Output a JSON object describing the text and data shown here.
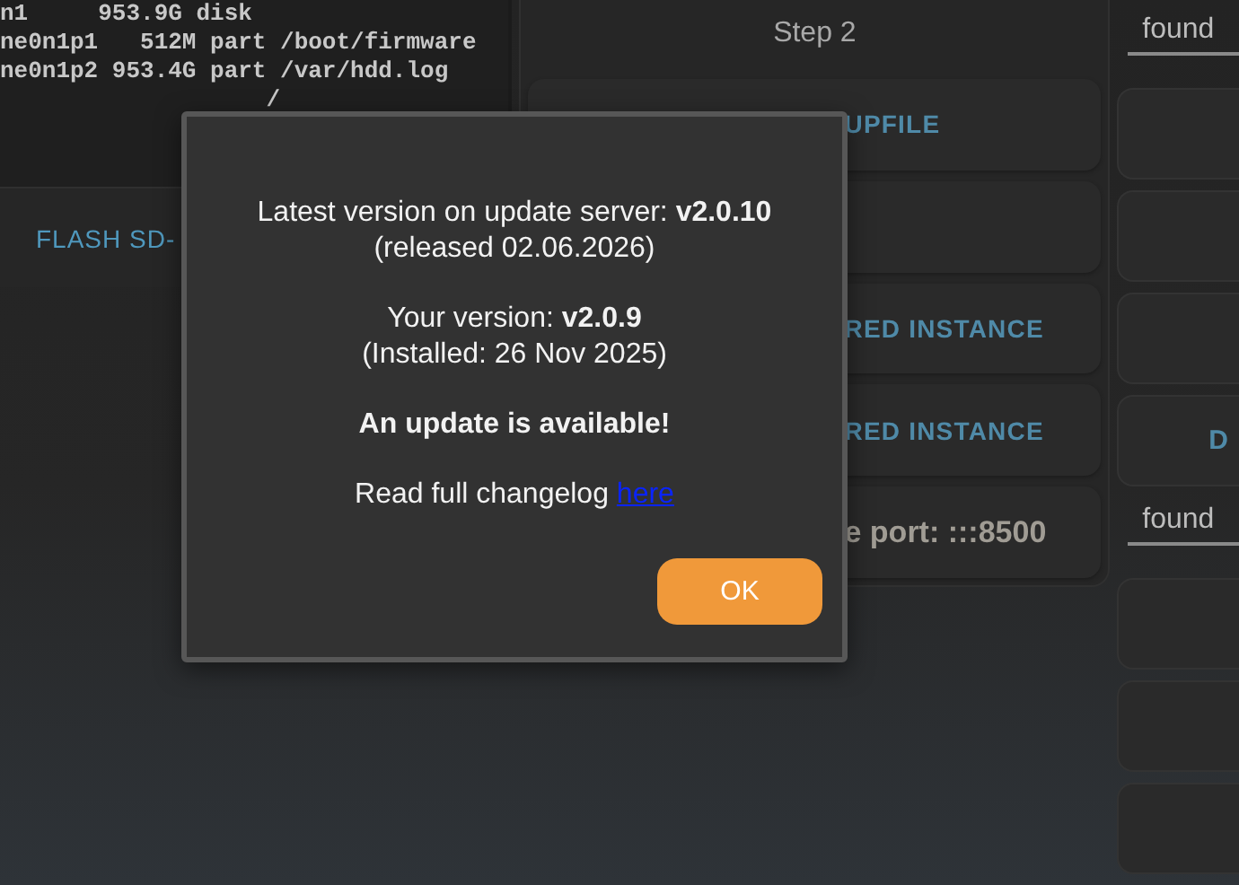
{
  "terminal": {
    "lines": [
      "n1     953.9G disk",
      "ne0n1p1   512M part /boot/firmware",
      "ne0n1p2 953.4G part /var/hdd.log",
      "                   /"
    ]
  },
  "left_panel": {
    "button": "FLASH SD-"
  },
  "middle_panel": {
    "title": "Step 2",
    "rows": [
      {
        "kind": "button",
        "label": "UPFILE"
      },
      {
        "kind": "empty"
      },
      {
        "kind": "button",
        "label": "RED INSTANCE"
      },
      {
        "kind": "button",
        "label": "RED INSTANCE"
      },
      {
        "kind": "status",
        "label": "e port: :::8500"
      }
    ]
  },
  "right_column": {
    "items": [
      {
        "kind": "field",
        "value": "found"
      },
      {
        "kind": "empty"
      },
      {
        "kind": "empty"
      },
      {
        "kind": "empty"
      },
      {
        "kind": "button",
        "label": "D"
      },
      {
        "kind": "field",
        "value": "found"
      },
      {
        "kind": "empty"
      },
      {
        "kind": "empty"
      },
      {
        "kind": "empty"
      }
    ]
  },
  "dialog": {
    "paragraphs": [
      {
        "kind": "text",
        "lines": [
          "Latest version on update server: **v2.0.10**",
          "(released 02.06.2026)"
        ]
      },
      {
        "kind": "text",
        "lines": [
          "Your version: **v2.0.9**",
          "(Installed: 26 Nov 2025)"
        ]
      },
      {
        "kind": "notice",
        "lines": [
          "An update is available!"
        ]
      },
      {
        "kind": "link",
        "lines": [
          "Read full changelog"
        ],
        "link": "here"
      }
    ],
    "button": "OK"
  }
}
